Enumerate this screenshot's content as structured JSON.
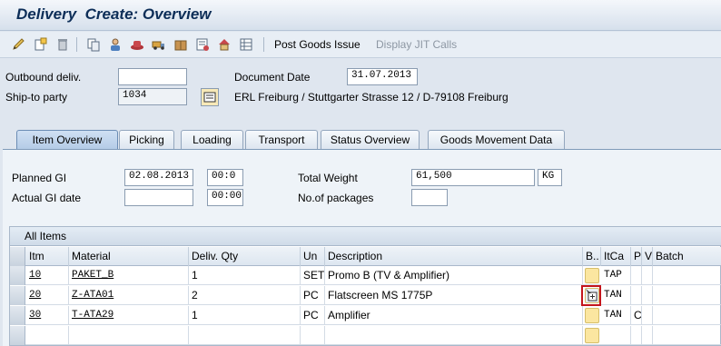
{
  "title": "Delivery  Create: Overview",
  "toolbar": {
    "icons": [
      "edit-pencil-icon",
      "new-item-icon",
      "delete-trash-icon",
      "copy-icon",
      "partner-icon",
      "hat-icon",
      "truck-icon",
      "package-icon",
      "document-icon",
      "house-icon"
    ],
    "post_goods_issue": "Post Goods Issue",
    "display_jit_calls": "Display JIT Calls"
  },
  "header": {
    "outbound_label": "Outbound deliv.",
    "outbound_value": "",
    "shipto_label": "Ship-to party",
    "shipto_value": "1034",
    "docdate_label": "Document Date",
    "docdate_value": "31.07.2013",
    "address": "ERL Freiburg / Stuttgarter Strasse 12 / D-79108 Freiburg"
  },
  "tabs": [
    {
      "label": "Item Overview",
      "active": true
    },
    {
      "label": "Picking"
    },
    {
      "label": "Loading"
    },
    {
      "label": "Transport"
    },
    {
      "label": "Status Overview"
    },
    {
      "label": "Goods Movement Data"
    }
  ],
  "panel": {
    "planned_gi_label": "Planned GI",
    "planned_gi_date": "02.08.2013",
    "planned_gi_time": "00:0",
    "actual_gi_label": "Actual GI date",
    "actual_gi_date": "",
    "actual_gi_time": "00:00",
    "total_weight_label": "Total Weight",
    "total_weight_value": "61,500",
    "weight_unit": "KG",
    "packages_label": "No.of packages",
    "packages_value": ""
  },
  "table": {
    "title": "All Items",
    "columns": [
      "Itm",
      "Material",
      "Deliv. Qty",
      "Un",
      "Description",
      "B..",
      "ItCa",
      "P",
      "V",
      "Batch"
    ],
    "rows": [
      {
        "itm": "10",
        "material": "PAKET_B",
        "qty": "1",
        "un": "SET",
        "description": "Promo B (TV & Amplifier)",
        "itca": "TAP",
        "p": ""
      },
      {
        "itm": "20",
        "material": "Z-ATA01",
        "qty": "2",
        "un": "PC",
        "description": "Flatscreen MS 1775P",
        "itca": "TAN",
        "p": ""
      },
      {
        "itm": "30",
        "material": "T-ATA29",
        "qty": "1",
        "un": "PC",
        "description": "Amplifier",
        "itca": "TAN",
        "p": "C"
      }
    ]
  },
  "colors": {
    "title": "#0d2e58",
    "highlight": "#c4161c",
    "batch_cell": "#fbe6a0"
  }
}
